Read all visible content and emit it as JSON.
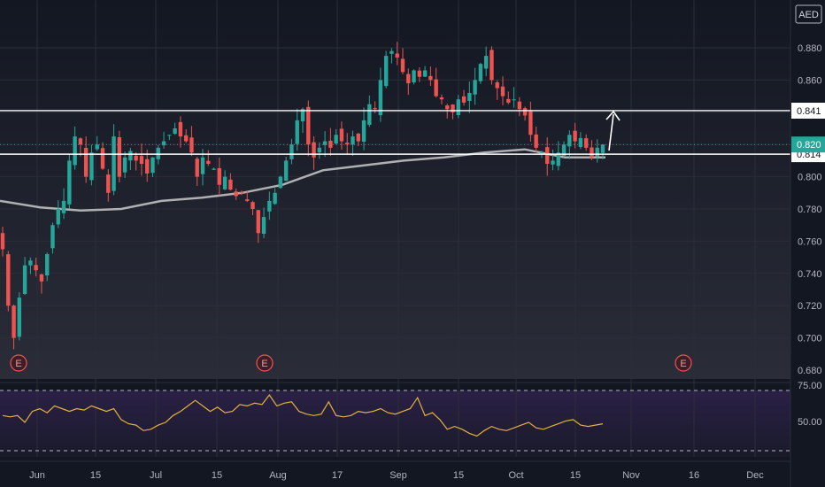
{
  "currency_label": "AED",
  "price_axis": {
    "ticks": [
      "0.880",
      "0.860",
      "0.841",
      "0.820",
      "0.814",
      "0.800",
      "0.780",
      "0.760",
      "0.740",
      "0.720",
      "0.700",
      "0.680"
    ]
  },
  "horizontal_lines": [
    {
      "price": 0.841,
      "label": "0.841",
      "color": "#ffffff"
    },
    {
      "price": 0.814,
      "label": "0.814",
      "color": "#ffffff"
    }
  ],
  "last_price": {
    "price": 0.82,
    "label": "0.820",
    "color": "#26a69a"
  },
  "x_axis": {
    "labels": [
      "Jun",
      "15",
      "Jul",
      "15",
      "Aug",
      "17",
      "Sep",
      "15",
      "Oct",
      "15",
      "Nov",
      "16",
      "Dec"
    ]
  },
  "rsi_axis": {
    "ticks": [
      "75.00",
      "50.00"
    ]
  },
  "earnings_markers": [
    {
      "label": "E"
    },
    {
      "label": "E"
    },
    {
      "label": "E"
    }
  ],
  "colors": {
    "background": "#131722",
    "up": "#26a69a",
    "down": "#ef5350",
    "ma": "#c9c9c9",
    "rsi": "#e2b23c",
    "rsi_band": "#2a2040"
  },
  "chart_data": {
    "type": "candlestick",
    "ylim": [
      0.675,
      0.895
    ],
    "moving_average": [
      0.785,
      0.781,
      0.779,
      0.78,
      0.785,
      0.787,
      0.79,
      0.795,
      0.804,
      0.807,
      0.81,
      0.812,
      0.815,
      0.817,
      0.812,
      0.812
    ],
    "rsi_values": [
      55,
      54,
      55,
      50,
      58,
      60,
      57,
      62,
      60,
      58,
      60,
      59,
      62,
      60,
      58,
      60,
      52,
      49,
      48,
      44,
      45,
      48,
      50,
      55,
      58,
      62,
      66,
      62,
      58,
      61,
      57,
      58,
      63,
      62,
      64,
      63,
      70,
      62,
      64,
      65,
      58,
      56,
      55,
      56,
      65,
      55,
      54,
      55,
      58,
      57,
      58,
      60,
      57,
      56,
      58,
      60,
      68,
      55,
      57,
      52,
      45,
      47,
      45,
      42,
      40,
      44,
      47,
      45,
      44,
      46,
      48,
      50,
      46,
      45,
      47,
      49,
      51,
      52,
      48,
      47,
      48,
      49
    ]
  }
}
